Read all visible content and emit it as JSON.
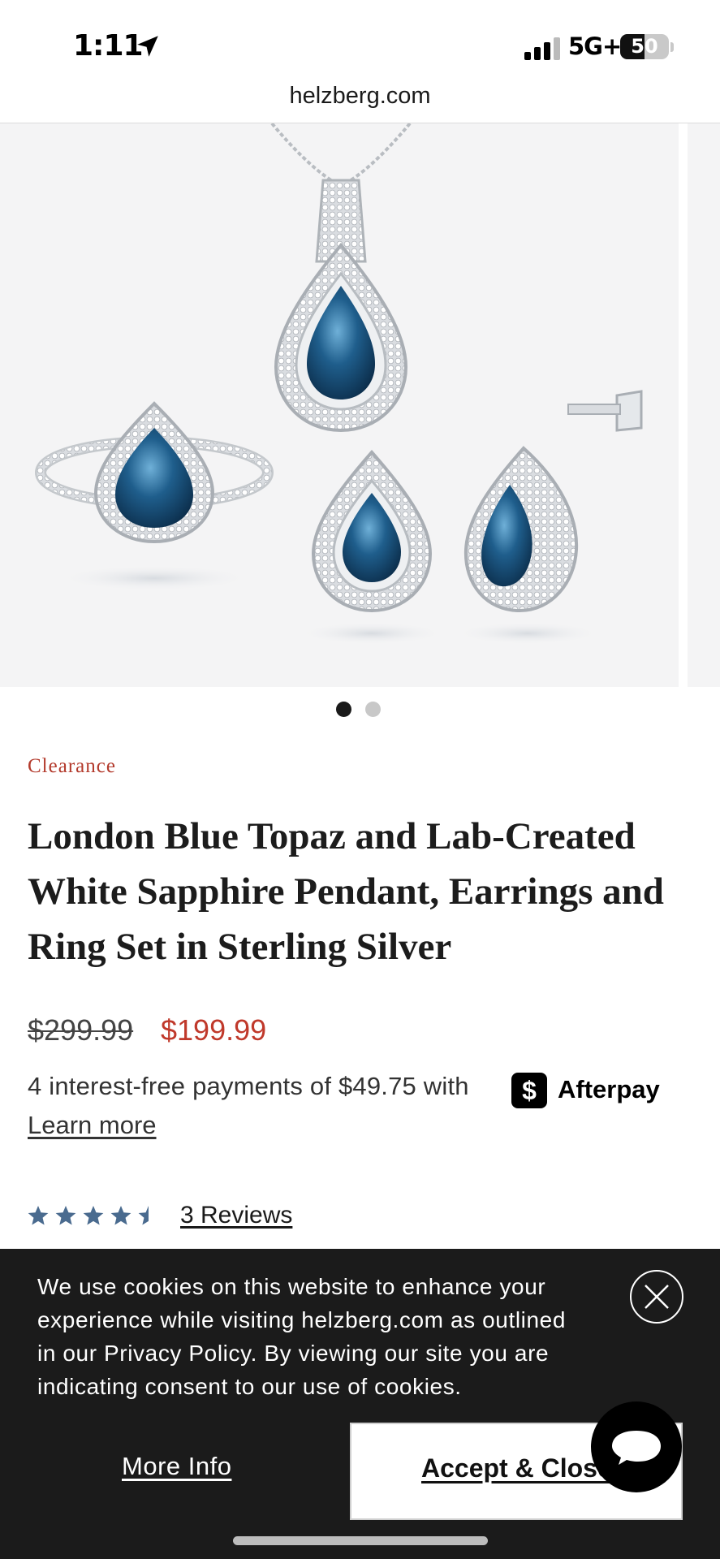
{
  "status_bar": {
    "time": "1:11",
    "network": "5G+",
    "battery_level": "50",
    "battery_fraction": 0.5,
    "icons": [
      "location-arrow-icon",
      "cellular-signal-icon",
      "battery-icon"
    ]
  },
  "browser": {
    "url": "helzberg.com"
  },
  "gallery": {
    "slide_count": 2,
    "active_slide": 1,
    "dot_active_color": "#1a1a1a",
    "dot_inactive_color": "#c8c8c8"
  },
  "product": {
    "badge": "Clearance",
    "title": "London Blue Topaz and Lab-Created White Sapphire Pendant, Earrings and Ring Set in Sterling Silver",
    "price_original": "$299.99",
    "price_sale": "$199.99",
    "afterpay_text": "4 interest-free payments of $49.75 with",
    "afterpay_brand": "Afterpay",
    "afterpay_icon": "$",
    "learn_more": "Learn more",
    "rating": 4.5,
    "reviews_link": "3 Reviews"
  },
  "cookie_banner": {
    "text": "We use cookies on this website to enhance your experience while visiting helzberg.com as outlined in our Privacy Policy. By viewing our site you are indicating consent to our use of cookies.",
    "more_info": "More Info",
    "accept": "Accept & Close"
  },
  "colors": {
    "sale_red": "#c0392b",
    "clearance_red": "#b33a2c",
    "star_blue": "#4a6b8f",
    "banner_bg": "#1b1b1b"
  }
}
